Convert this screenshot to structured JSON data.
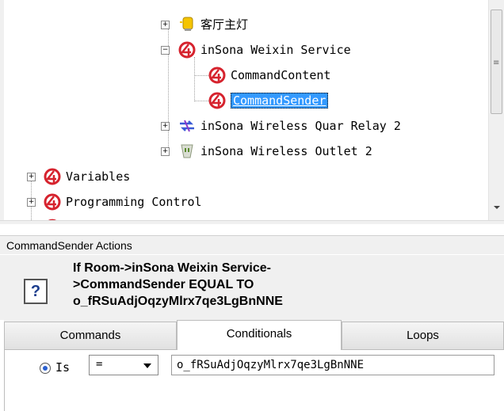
{
  "tree": {
    "nodes": [
      {
        "label": "客厅主灯",
        "icon": "light-bulb-icon"
      },
      {
        "label": "inSona Weixin Service",
        "icon": "insona-logo-icon"
      },
      {
        "label": "CommandContent",
        "icon": "insona-logo-icon"
      },
      {
        "label": "CommandSender",
        "icon": "insona-logo-icon",
        "selected": true
      },
      {
        "label": "inSona Wireless Quar Relay 2",
        "icon": "relay-arrows-icon"
      },
      {
        "label": "inSona Wireless Outlet 2",
        "icon": "outlet-icon"
      },
      {
        "label": "Variables",
        "icon": "insona-logo-icon"
      },
      {
        "label": "Programming Control",
        "icon": "insona-logo-icon"
      }
    ]
  },
  "actions": {
    "header": "CommandSender Actions",
    "description": "If Room->inSona Weixin Service->CommandSender EQUAL TO o_fRSuAdjOqzyMlrx7qe3LgBnNNE"
  },
  "tabs": [
    {
      "label": "Commands"
    },
    {
      "label": "Conditionals",
      "active": true
    },
    {
      "label": "Loops"
    }
  ],
  "conditional": {
    "radio_label": "Is",
    "operator": "=",
    "value": "o_fRSuAdjOqzyMlrx7qe3LgBnNNE"
  },
  "colors": {
    "selection": "#3399ff",
    "logo_red": "#d6232e"
  }
}
